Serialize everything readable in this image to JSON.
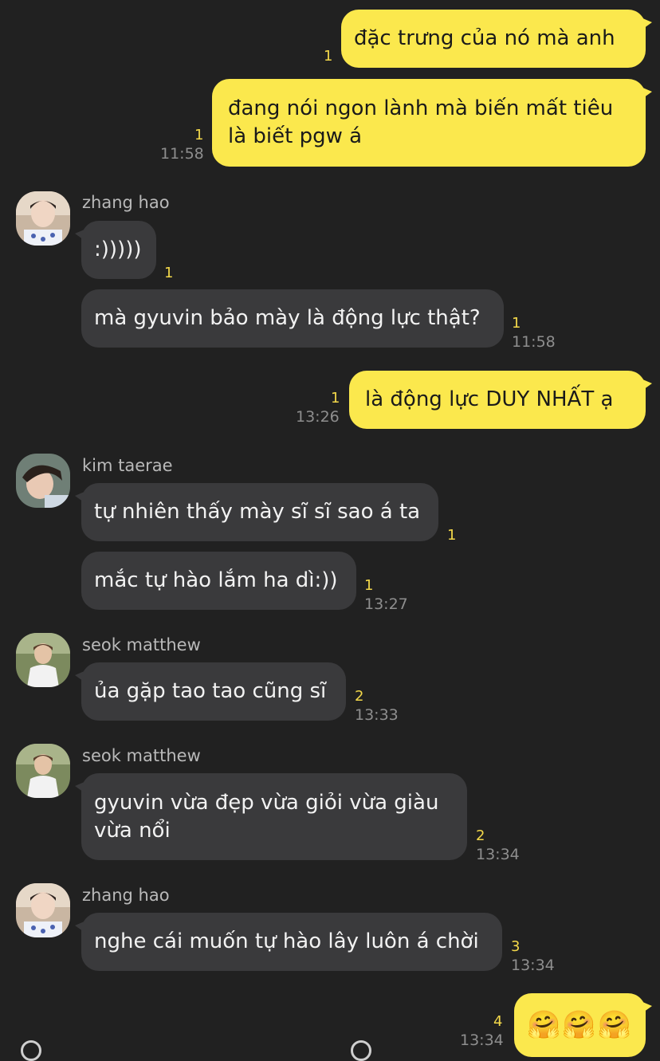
{
  "messages": [
    {
      "text": "đặc trưng của nó mà anh",
      "unread": "1",
      "time": ""
    },
    {
      "text": "đang nói ngon lành mà biến mất tiêu\nlà biết pgw á",
      "unread": "1",
      "time": "11:58"
    },
    {
      "sender": "zhang hao",
      "text": ":)))))",
      "unread": "1",
      "time": ""
    },
    {
      "text": "mà gyuvin bảo mày là động lực thật?",
      "unread": "1",
      "time": "11:58"
    },
    {
      "text": "là động lực DUY NHẤT ạ",
      "unread": "1",
      "time": "13:26"
    },
    {
      "sender": "kim taerae",
      "text": "tự nhiên thấy mày sĩ sĩ sao á ta",
      "unread": "1",
      "time": ""
    },
    {
      "text": "mắc tự hào lắm ha dì:))",
      "unread": "1",
      "time": "13:27"
    },
    {
      "sender": "seok matthew",
      "text": "ủa gặp tao tao cũng sĩ",
      "unread": "2",
      "time": "13:33"
    },
    {
      "sender": "seok matthew",
      "text": "gyuvin vừa đẹp vừa giỏi vừa giàu\nvừa nổi",
      "unread": "2",
      "time": "13:34"
    },
    {
      "sender": "zhang hao",
      "text": "nghe cái muốn tự hào lây luôn á chời",
      "unread": "3",
      "time": "13:34"
    },
    {
      "text": "🤗🤗🤗",
      "unread": "4",
      "time": "13:34"
    }
  ],
  "colors": {
    "background": "#212121",
    "outgoing_bubble": "#fbe84d",
    "incoming_bubble": "#3a3a3c",
    "unread_count": "#f3d84a",
    "timestamp": "#8e8e8e"
  },
  "icons": {
    "avatar_zhang_hao": "avatar-zhang-hao",
    "avatar_kim_taerae": "avatar-kim-taerae",
    "avatar_seok_matthew": "avatar-seok-matthew"
  }
}
